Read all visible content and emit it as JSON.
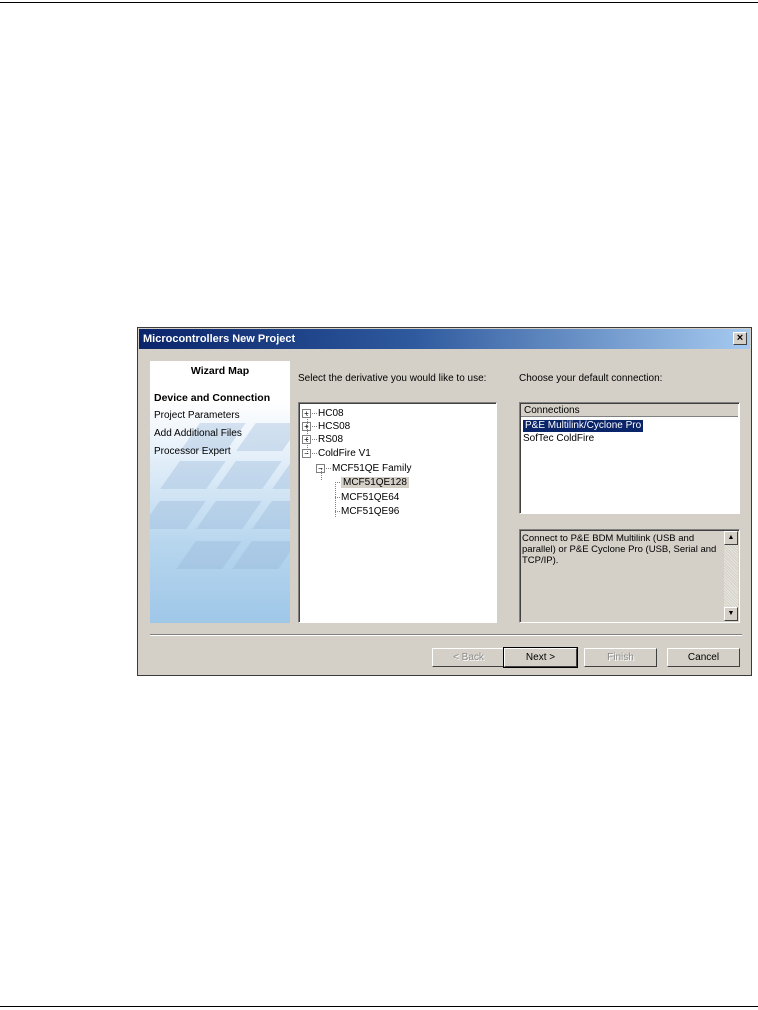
{
  "dialog": {
    "title": "Microcontrollers New Project",
    "close_glyph": "×"
  },
  "wizard_map": {
    "title": "Wizard Map",
    "items": [
      {
        "label": "Device and Connection",
        "active": true
      },
      {
        "label": "Project Parameters",
        "active": false
      },
      {
        "label": "Add Additional Files",
        "active": false
      },
      {
        "label": "Processor Expert",
        "active": false
      }
    ]
  },
  "derivative": {
    "prompt": "Select the derivative you would like to use:",
    "tree": [
      {
        "label": "HC08",
        "expander": "+"
      },
      {
        "label": "HCS08",
        "expander": "+"
      },
      {
        "label": "RS08",
        "expander": "+"
      },
      {
        "label": "ColdFire V1",
        "expander": "−"
      },
      {
        "label": "MCF51QE Family",
        "expander": "−"
      },
      {
        "label": "MCF51QE128",
        "selected": true
      },
      {
        "label": "MCF51QE64"
      },
      {
        "label": "MCF51QE96"
      }
    ]
  },
  "connection": {
    "prompt": "Choose your default connection:",
    "header": "Connections",
    "items": [
      {
        "label": "P&E Multilink/Cyclone Pro",
        "selected": true
      },
      {
        "label": "SofTec ColdFire",
        "selected": false
      }
    ],
    "description": "Connect to P&E BDM Multilink (USB and parallel) or P&E Cyclone Pro (USB, Serial and TCP/IP)."
  },
  "buttons": {
    "back": "< Back",
    "next": "Next >",
    "finish": "Finish",
    "cancel": "Cancel"
  },
  "icons": {
    "scroll_up": "▲",
    "scroll_down": "▼"
  }
}
